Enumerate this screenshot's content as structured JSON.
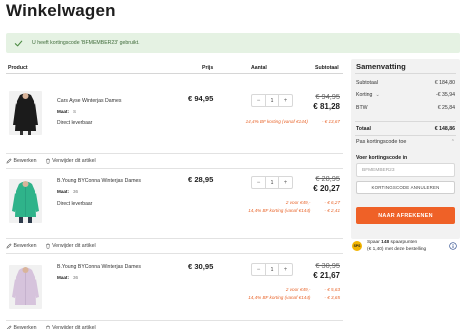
{
  "page": {
    "title": "Winkelwagen"
  },
  "alert": {
    "message": "U heeft kortingscode 'BFMEMBER23' gebruikt.",
    "color": "#e5f2e3"
  },
  "cart": {
    "headers": {
      "product": "Product",
      "price": "Prijs",
      "quantity": "Aantal",
      "subtotal": "Subtotaal"
    },
    "size_label": "Maat:",
    "edit_label": "Bewerken",
    "remove_label": "Verwijder dit artikel",
    "items": [
      {
        "name": "Cars Ayse Winterjas Dames",
        "size": "S",
        "stock": "Direct leverbaar",
        "price": "€ 94,95",
        "quantity": "1",
        "old_subtotal": "€ 94,95",
        "new_subtotal": "€ 81,28",
        "discounts": [
          {
            "label": "14,4% BF korting (vanaf €144)",
            "amount": "- € 13,67"
          }
        ],
        "image_color": "#1a1a1a"
      },
      {
        "name": "B.Young BYConna Winterjas Dames",
        "size": "36",
        "stock": "Direct leverbaar",
        "price": "€ 28,95",
        "quantity": "1",
        "old_subtotal": "€ 28,95",
        "new_subtotal": "€ 20,27",
        "discounts": [
          {
            "label": "2 voor €49,-",
            "amount": "- € 6,27"
          },
          {
            "label": "14,4% BF korting (vanaf €144)",
            "amount": "- € 2,41"
          }
        ],
        "image_color": "#2fb38a"
      },
      {
        "name": "B.Young BYConna Winterjas Dames",
        "size": "36",
        "stock": "Direct leverbaar",
        "price": "€ 30,95",
        "quantity": "1",
        "old_subtotal": "€ 30,95",
        "new_subtotal": "€ 21,67",
        "discounts": [
          {
            "label": "2 voor €49,-",
            "amount": "- € 5,63"
          },
          {
            "label": "14,4% BF korting (vanaf €144)",
            "amount": "- € 3,65"
          }
        ],
        "image_color": "#d6c3dc"
      }
    ]
  },
  "summary": {
    "title": "Samenvatting",
    "subtotal_label": "Subtotaal",
    "subtotal_value": "€ 184,80",
    "discount_label": "Korting",
    "discount_value": "-€ 35,94",
    "vat_label": "BTW",
    "vat_value": "€ 25,84",
    "total_label": "Totaal",
    "total_value": "€ 148,86",
    "apply_code_label": "Pas kortingscode toe",
    "code_heading": "Voer kortingscode in",
    "code_value": "BFMEMBER23",
    "cancel_code_label": "KORTINGSCODE ANNULEREN",
    "checkout_label": "NAAR AFREKENEN",
    "accent": "#ef6127"
  },
  "points": {
    "badge": "SPS",
    "prefix": "Spaar",
    "count": "148",
    "line1_rest": "spaarpunten",
    "line2": "(€ 1,40) met deze bestelling"
  }
}
